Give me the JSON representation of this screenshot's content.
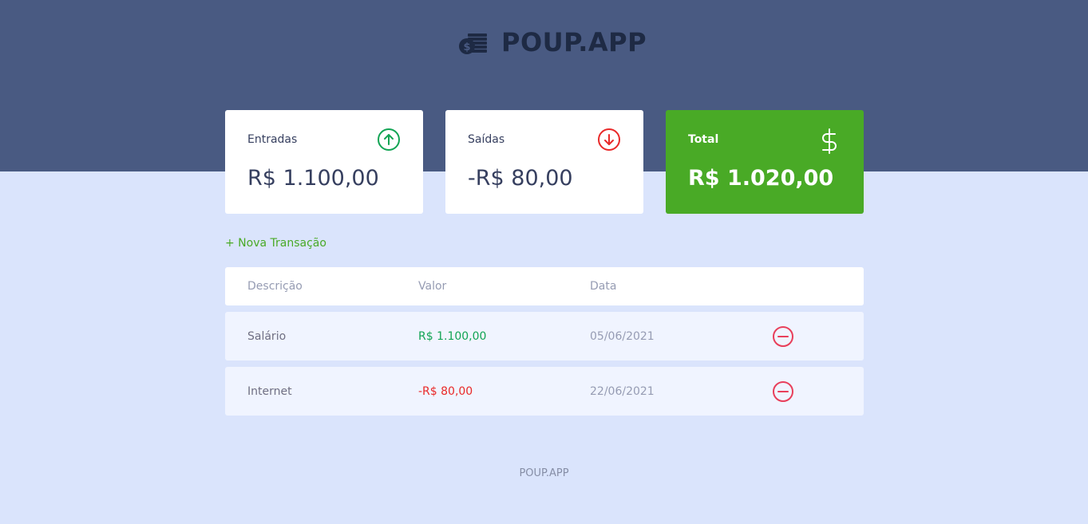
{
  "header": {
    "logo_text": "POUP.APP",
    "logo_icon": "coins-icon"
  },
  "balance": {
    "income": {
      "label": "Entradas",
      "value": "R$ 1.100,00",
      "icon": "arrow-up-circle-icon",
      "color": "#12a454"
    },
    "expense": {
      "label": "Saídas",
      "value": "-R$ 80,00",
      "icon": "arrow-down-circle-icon",
      "color": "#e92929"
    },
    "total": {
      "label": "Total",
      "value": "R$ 1.020,00",
      "icon": "dollar-sign-icon",
      "color": "#49aa26"
    }
  },
  "new_transaction_label": "+ Nova Transação",
  "table": {
    "headers": [
      "Descrição",
      "Valor",
      "Data"
    ],
    "rows": [
      {
        "description": "Salário",
        "amount": "R$ 1.100,00",
        "type": "income",
        "date": "05/06/2021"
      },
      {
        "description": "Internet",
        "amount": "-R$ 80,00",
        "type": "expense",
        "date": "22/06/2021"
      }
    ]
  },
  "footer": {
    "text": "POUP.APP"
  }
}
